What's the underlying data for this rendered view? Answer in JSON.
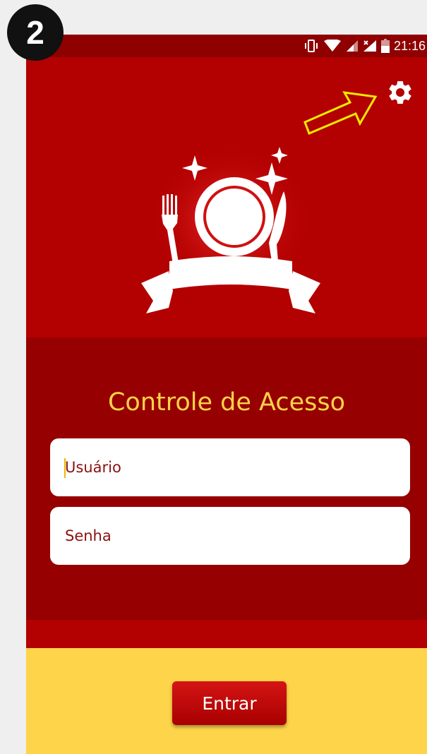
{
  "step_badge": "2",
  "status_bar": {
    "time": "21:16",
    "icons": [
      "vibrate-icon",
      "wifi-icon",
      "signal-icon",
      "signal-no-data-icon",
      "battery-icon"
    ]
  },
  "header": {
    "settings_icon": "gear-icon",
    "hint_arrow_icon": "arrow-right-icon"
  },
  "logo": {
    "icon": "restaurant-plate-cutlery-logo"
  },
  "login": {
    "title": "Controle de Acesso",
    "username": {
      "placeholder": "Usuário",
      "value": ""
    },
    "password": {
      "placeholder": "Senha",
      "value": ""
    }
  },
  "footer": {
    "submit_label": "Entrar"
  },
  "colors": {
    "primary_red": "#b30000",
    "dark_red": "#960000",
    "status_bar": "#8f0000",
    "accent_yellow": "#fed44a",
    "title_yellow": "#ffd24a",
    "field_text": "#8a1212"
  }
}
